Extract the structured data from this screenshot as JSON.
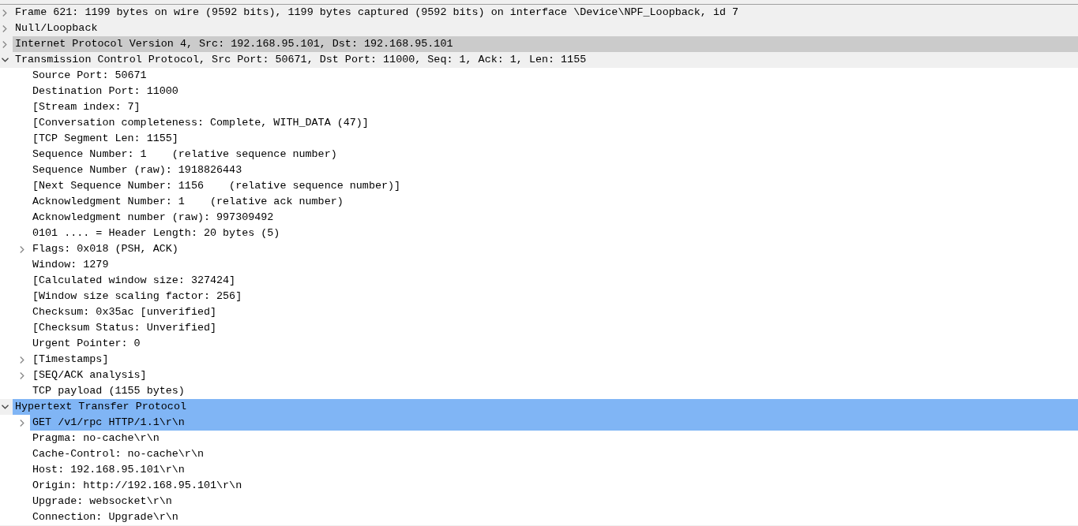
{
  "tree": [
    {
      "label": "Frame 621: 1199 bytes on wire (9592 bits), 1199 bytes captured (9592 bits) on interface \\Device\\NPF_Loopback, id 7",
      "expanded": false,
      "selected": false,
      "hovered": false
    },
    {
      "label": "Null/Loopback",
      "expanded": false,
      "selected": false,
      "hovered": false
    },
    {
      "label": "Internet Protocol Version 4, Src: 192.168.95.101, Dst: 192.168.95.101",
      "expanded": false,
      "selected": false,
      "hovered": true
    },
    {
      "label": "Transmission Control Protocol, Src Port: 50671, Dst Port: 11000, Seq: 1, Ack: 1, Len: 1155",
      "expanded": true,
      "selected": false,
      "hovered": false,
      "children": [
        {
          "label": "Source Port: 50671",
          "selected": false,
          "hovered": false
        },
        {
          "label": "Destination Port: 11000",
          "selected": false,
          "hovered": false
        },
        {
          "label": "[Stream index: 7]",
          "selected": false,
          "hovered": false
        },
        {
          "label": "[Conversation completeness: Complete, WITH_DATA (47)]",
          "selected": false,
          "hovered": false
        },
        {
          "label": "[TCP Segment Len: 1155]",
          "selected": false,
          "hovered": false
        },
        {
          "label": "Sequence Number: 1    (relative sequence number)",
          "selected": false,
          "hovered": false
        },
        {
          "label": "Sequence Number (raw): 1918826443",
          "selected": false,
          "hovered": false
        },
        {
          "label": "[Next Sequence Number: 1156    (relative sequence number)]",
          "selected": false,
          "hovered": false
        },
        {
          "label": "Acknowledgment Number: 1    (relative ack number)",
          "selected": false,
          "hovered": false
        },
        {
          "label": "Acknowledgment number (raw): 997309492",
          "selected": false,
          "hovered": false
        },
        {
          "label": "0101 .... = Header Length: 20 bytes (5)",
          "selected": false,
          "hovered": false
        },
        {
          "label": "Flags: 0x018 (PSH, ACK)",
          "expanded": false,
          "selected": false,
          "hovered": false
        },
        {
          "label": "Window: 1279",
          "selected": false,
          "hovered": false
        },
        {
          "label": "[Calculated window size: 327424]",
          "selected": false,
          "hovered": false
        },
        {
          "label": "[Window size scaling factor: 256]",
          "selected": false,
          "hovered": false
        },
        {
          "label": "Checksum: 0x35ac [unverified]",
          "selected": false,
          "hovered": false
        },
        {
          "label": "[Checksum Status: Unverified]",
          "selected": false,
          "hovered": false
        },
        {
          "label": "Urgent Pointer: 0",
          "selected": false,
          "hovered": false
        },
        {
          "label": "[Timestamps]",
          "expanded": false,
          "selected": false,
          "hovered": false
        },
        {
          "label": "[SEQ/ACK analysis]",
          "expanded": false,
          "selected": false,
          "hovered": false
        },
        {
          "label": "TCP payload (1155 bytes)",
          "selected": false,
          "hovered": false
        }
      ]
    },
    {
      "label": "Hypertext Transfer Protocol",
      "expanded": true,
      "selected": true,
      "hovered": false,
      "children": [
        {
          "label": "GET /v1/rpc HTTP/1.1\\r\\n",
          "expanded": false,
          "selected": true,
          "hovered": false
        },
        {
          "label": "Pragma: no-cache\\r\\n",
          "selected": false,
          "hovered": false
        },
        {
          "label": "Cache-Control: no-cache\\r\\n",
          "selected": false,
          "hovered": false
        },
        {
          "label": "Host: 192.168.95.101\\r\\n",
          "selected": false,
          "hovered": false
        },
        {
          "label": "Origin: http://192.168.95.101\\r\\n",
          "selected": false,
          "hovered": false
        },
        {
          "label": "Upgrade: websocket\\r\\n",
          "selected": false,
          "hovered": false
        },
        {
          "label": "Connection: Upgrade\\r\\n",
          "selected": false,
          "hovered": false
        }
      ]
    }
  ]
}
